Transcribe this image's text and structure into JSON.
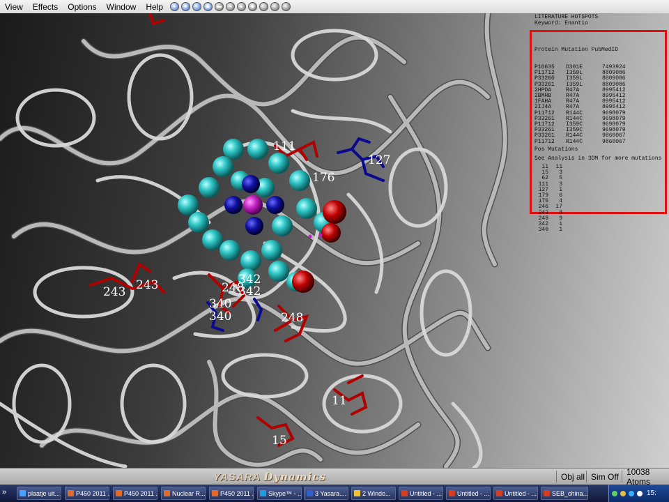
{
  "menu": [
    "View",
    "Effects",
    "Options",
    "Window",
    "Help"
  ],
  "toolbar_icons": [
    "globe-icon",
    "disk-icon",
    "camera-icon",
    "capture-icon",
    "movie-icon",
    "back-icon",
    "eject-icon",
    "eye-icon",
    "film-icon",
    "rewind-icon",
    "fastforward-icon"
  ],
  "literature": {
    "title": "LITERATURE HOTSPOTS",
    "keyword": "Keyword: Enantio",
    "header": "Protein Mutation PubMedID",
    "rows": [
      [
        "P10635",
        "D301E",
        "7493924"
      ],
      [
        "P11712",
        "I359L",
        "8809086"
      ],
      [
        "P33260",
        "I359L",
        "8809086"
      ],
      [
        "P33261",
        "I359L",
        "8809086"
      ],
      [
        "2HPDA",
        "R47A",
        "8995412"
      ],
      [
        "2BMHB",
        "R47A",
        "8995412"
      ],
      [
        "1FAHA",
        "R47A",
        "8995412"
      ],
      [
        "2IJ4A",
        "R47A",
        "8995412"
      ],
      [
        "P11712",
        "R144C",
        "9698079"
      ],
      [
        "P33261",
        "R144C",
        "9698079"
      ],
      [
        "P11712",
        "I359C",
        "9698079"
      ],
      [
        "P33261",
        "I359C",
        "9698079"
      ],
      [
        "P33261",
        "R144C",
        "9860067"
      ],
      [
        "P11712",
        "R144C",
        "9860067"
      ]
    ],
    "note": "See Analysis in 3DM for more mutations",
    "pos_header": "Pos Mutations",
    "positions": [
      [
        "11",
        "11"
      ],
      [
        "15",
        "3"
      ],
      [
        "62",
        "5"
      ],
      [
        "111",
        "3"
      ],
      [
        "127",
        "1"
      ],
      [
        "179",
        "6"
      ],
      [
        "176",
        "4"
      ],
      [
        "246",
        "17"
      ],
      [
        "243",
        "8"
      ],
      [
        "248",
        "9"
      ],
      [
        "342",
        "1"
      ],
      [
        "340",
        "1"
      ]
    ]
  },
  "residue_labels": [
    "243",
    "243",
    "248",
    "342",
    "342",
    "340",
    "340",
    "248",
    "176",
    "127",
    "111",
    "15",
    "11"
  ],
  "status": {
    "logo": "YASARA",
    "logo_sub": "Dynamics",
    "obj": "Obj  all",
    "sim": "Sim Off",
    "atoms": "10038 Atoms"
  },
  "taskbar": {
    "items": [
      "plaatje uit...",
      "P450 2011 ...",
      "P450 2011 ...",
      "Nuclear R...",
      "P450 2011 ...",
      "Skype™ - ...",
      "3 Yasara....",
      "2 Windo...",
      "Untitled - ...",
      "Untitled - ...",
      "Untitled - ...",
      "SEB_china..."
    ],
    "time": "15:"
  },
  "colors": {
    "panel_border": "#e01010",
    "heme_carbon": "#2ec4c4",
    "heme_nitrogen": "#1010a0",
    "iron": "#c020c0",
    "oxygen": "#c00000",
    "mutation_red": "#b00000",
    "mutation_blue": "#0a0a90"
  }
}
